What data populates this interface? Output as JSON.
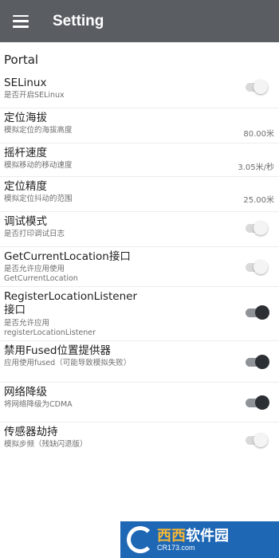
{
  "appbar": {
    "title": "Setting",
    "menu_icon": "hamburger-menu-icon"
  },
  "category": "Portal",
  "settings": [
    {
      "title": "SELinux",
      "summary": "是否开启SELinux",
      "type": "switch",
      "on": false
    },
    {
      "title": "定位海拔",
      "summary": "模拟定位的海拔高度",
      "type": "value",
      "value": "80.00米"
    },
    {
      "title": "摇杆速度",
      "summary": "模拟移动的移动速度",
      "type": "value",
      "value": "3.05米/秒"
    },
    {
      "title": "定位精度",
      "summary": "模拟定位抖动的范围",
      "type": "value",
      "value": "25.00米"
    },
    {
      "title": "调试模式",
      "summary": "是否打印调试日志",
      "type": "switch",
      "on": false
    },
    {
      "title": "GetCurrentLocation接口",
      "summary": "是否允许应用使用 GetCurrentLocation",
      "type": "switch",
      "on": false
    },
    {
      "title": "RegisterLocationListener接口",
      "summary": "是否允许应用 registerLocationListener",
      "type": "switch",
      "on": true
    },
    {
      "title": "禁用Fused位置提供器",
      "summary": "应用使用fused（可能导致模拟失败）",
      "type": "switch",
      "on": true
    },
    {
      "title": "网络降级",
      "summary": "将网络降级为CDMA",
      "type": "switch",
      "on": true
    },
    {
      "title": "传感器劫持",
      "summary": "模拟步频（残缺闪退版）",
      "type": "switch",
      "on": false
    }
  ],
  "watermark": {
    "brand_a": "西",
    "brand_b": "西",
    "brand_c": "软件园",
    "domain": "CR173.com"
  }
}
